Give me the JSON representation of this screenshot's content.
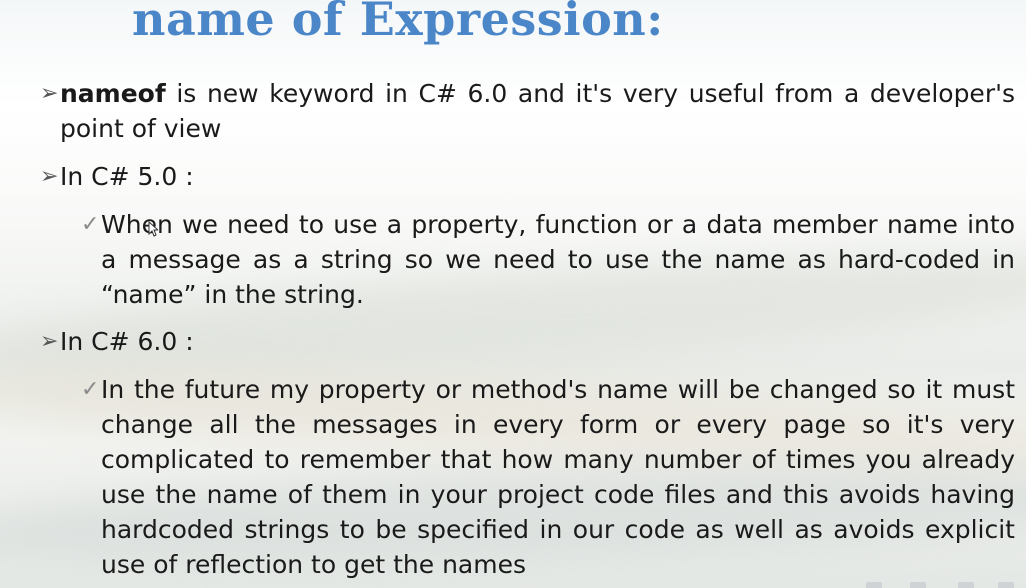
{
  "slide": {
    "title": "name of  Expression:",
    "bullets": [
      {
        "marker": "➢",
        "keyword": "nameof",
        "text": " is new keyword in C# 6.0 and it's very useful from a developer's point of view"
      },
      {
        "marker": "➢",
        "text": "In C# 5.0 :",
        "sub": {
          "marker": "✓",
          "text": "When we need to use a property, function or a data member name into a message as a string so we need to use the name as hard-coded in “name” in the string."
        }
      },
      {
        "marker": "➢",
        "text": "In C# 6.0 :",
        "sub": {
          "marker": "✓",
          "text": "In the future my property or method's name will be changed so it must change all the messages in every form or every page so it's very complicated to remember that how many number of times you already use the name of them in your project code files and this avoids having hardcoded strings to be specified in our code as well as avoids explicit use of reflection to get the names"
        }
      }
    ]
  },
  "icons": {
    "level1_bullet": "arrowhead-bullet-icon",
    "level2_bullet": "checkmark-bullet-icon",
    "pointer": "mouse-cursor-icon"
  },
  "colors": {
    "title": "#4a86c8",
    "text": "#1a1a1a"
  }
}
